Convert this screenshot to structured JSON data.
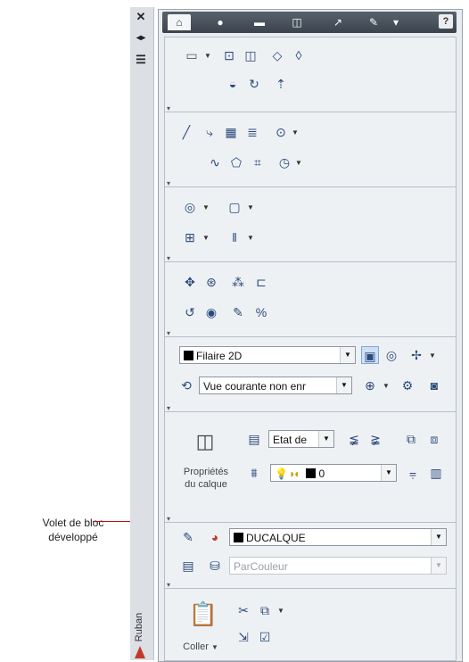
{
  "callout": {
    "line1": "Volet de bloc",
    "line2": "développé"
  },
  "side_strip": {
    "close_glyph": "✕",
    "dock_glyph": "◂▸",
    "menu_glyph": "☰",
    "label": "Ruban"
  },
  "tabs": [
    {
      "icon": "home-icon",
      "glyph": "⌂"
    },
    {
      "icon": "solid-icon",
      "glyph": "●"
    },
    {
      "icon": "mesh-icon",
      "glyph": "▬"
    },
    {
      "icon": "render-icon",
      "glyph": "◫"
    },
    {
      "icon": "annotate-icon",
      "glyph": "↗"
    },
    {
      "icon": "tools-icon",
      "glyph": "✎"
    },
    {
      "icon": "wrench-icon",
      "glyph": "▾"
    }
  ],
  "help_glyph": "?",
  "visual_style": {
    "value": "Filaire 2D"
  },
  "view": {
    "value": "Vue courante non enr"
  },
  "layers": {
    "state_value": "Etat de",
    "label_line1": "Propriétés",
    "label_line2": "du calque",
    "layer_value": "0"
  },
  "properties": {
    "color_value": "DUCALQUE",
    "linetype_value": "ParCouleur"
  },
  "clipboard": {
    "paste_label": "Coller"
  },
  "colors": {
    "accent": "#3b6fb0",
    "panel_bg": "#eef1f4",
    "tab_bar": "#4a535e"
  }
}
